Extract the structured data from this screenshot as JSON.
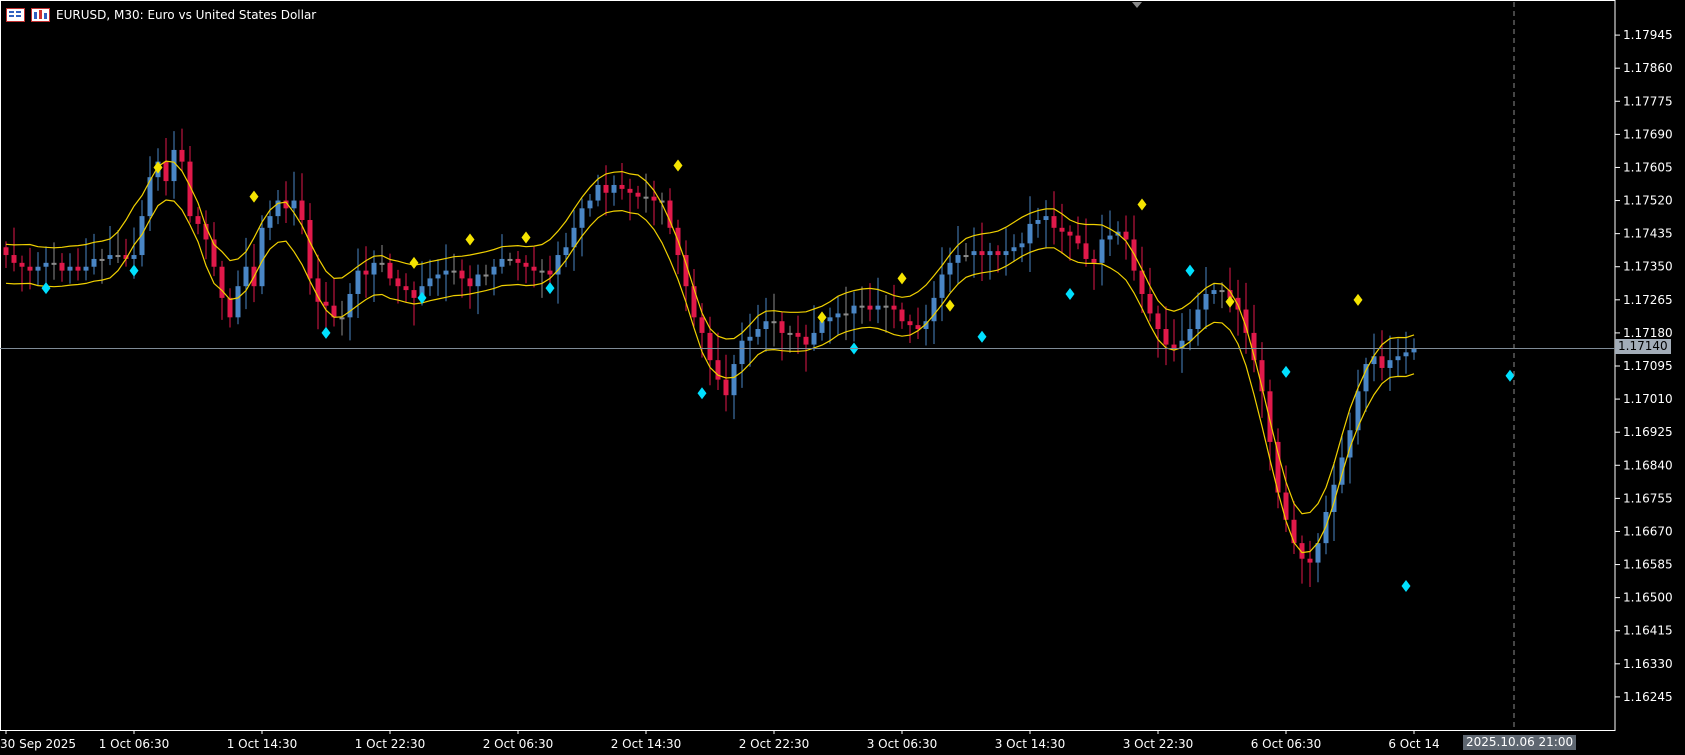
{
  "header": {
    "symbol_line": "EURUSD, M30:  Euro vs United States Dollar"
  },
  "current_price_label": "1.17140",
  "current_datetime_label": "2025.10.06 21:00",
  "colors": {
    "background": "#000000",
    "bull": "#4a86c5",
    "bear": "#e0194a",
    "neutral": "#8c8c8c",
    "band": "#f0d000",
    "buy_signal": "#00e0ff",
    "sell_signal": "#f5e400",
    "axis": "#ffffff",
    "price_line": "#7f8b97"
  },
  "chart_data": {
    "type": "candlestick",
    "y_axis": {
      "range": [
        1.1616,
        1.1803
      ],
      "ticks": [
        "1.17945",
        "1.17860",
        "1.17775",
        "1.17690",
        "1.17605",
        "1.17520",
        "1.17435",
        "1.17350",
        "1.17265",
        "1.17180",
        "1.17095",
        "1.17010",
        "1.16925",
        "1.16840",
        "1.16755",
        "1.16670",
        "1.16585",
        "1.16500",
        "1.16415",
        "1.16330",
        "1.16245"
      ]
    },
    "x_axis": {
      "ticks": [
        {
          "label": "30 Sep 2025",
          "bar": 0
        },
        {
          "label": "1 Oct 06:30",
          "bar": 16
        },
        {
          "label": "1 Oct 14:30",
          "bar": 32
        },
        {
          "label": "1 Oct 22:30",
          "bar": 48
        },
        {
          "label": "2 Oct 06:30",
          "bar": 64
        },
        {
          "label": "2 Oct 14:30",
          "bar": 80
        },
        {
          "label": "2 Oct 22:30",
          "bar": 96
        },
        {
          "label": "3 Oct 06:30",
          "bar": 112
        },
        {
          "label": "3 Oct 14:30",
          "bar": 128
        },
        {
          "label": "3 Oct 22:30",
          "bar": 144
        },
        {
          "label": "6 Oct 06:30",
          "bar": 160
        },
        {
          "label": "6 Oct 14",
          "bar": 176
        }
      ]
    },
    "current_price": 1.1714,
    "series_close": [
      1.1738,
      1.1736,
      1.1735,
      1.1734,
      1.1735,
      1.1736,
      1.1736,
      1.1734,
      1.1735,
      1.1734,
      1.1735,
      1.1737,
      1.1737,
      1.1738,
      1.1738,
      1.1737,
      1.1738,
      1.1748,
      1.1758,
      1.1762,
      1.1757,
      1.1765,
      1.1762,
      1.1748,
      1.1746,
      1.1742,
      1.1735,
      1.1727,
      1.1722,
      1.173,
      1.1735,
      1.173,
      1.1745,
      1.1748,
      1.1752,
      1.175,
      1.1752,
      1.1747,
      1.1732,
      1.1726,
      1.1725,
      1.1722,
      1.1722,
      1.1728,
      1.1734,
      1.1733,
      1.1736,
      1.1736,
      1.1732,
      1.173,
      1.1729,
      1.1727,
      1.173,
      1.1732,
      1.1733,
      1.1734,
      1.1734,
      1.1732,
      1.173,
      1.1733,
      1.1733,
      1.1735,
      1.1737,
      1.1737,
      1.1736,
      1.1735,
      1.1734,
      1.1734,
      1.1733,
      1.1738,
      1.174,
      1.1745,
      1.175,
      1.1752,
      1.1756,
      1.1754,
      1.1756,
      1.1755,
      1.1754,
      1.1753,
      1.1753,
      1.1752,
      1.1752,
      1.1745,
      1.1738,
      1.173,
      1.1722,
      1.1718,
      1.1711,
      1.1706,
      1.1702,
      1.171,
      1.1716,
      1.1717,
      1.1719,
      1.1721,
      1.1721,
      1.1718,
      1.1718,
      1.1717,
      1.1715,
      1.1718,
      1.1721,
      1.1722,
      1.1723,
      1.1723,
      1.1725,
      1.1725,
      1.1724,
      1.1725,
      1.1725,
      1.1724,
      1.1721,
      1.172,
      1.1719,
      1.1721,
      1.1727,
      1.1733,
      1.1736,
      1.1738,
      1.1738,
      1.1739,
      1.1738,
      1.1739,
      1.1738,
      1.1739,
      1.174,
      1.1741,
      1.1746,
      1.1747,
      1.1748,
      1.1745,
      1.1744,
      1.1743,
      1.1741,
      1.1737,
      1.1736,
      1.1742,
      1.1743,
      1.1744,
      1.1742,
      1.1734,
      1.1728,
      1.1723,
      1.1719,
      1.1715,
      1.1714,
      1.1716,
      1.1719,
      1.1724,
      1.1728,
      1.1729,
      1.1729,
      1.1727,
      1.1724,
      1.1718,
      1.1711,
      1.1703,
      1.169,
      1.1677,
      1.167,
      1.1664,
      1.166,
      1.1659,
      1.1664,
      1.1672,
      1.1679,
      1.1686,
      1.1693,
      1.1703,
      1.171,
      1.1712,
      1.1709,
      1.1711,
      1.1712,
      1.1713,
      1.1714
    ]
  },
  "signals": {
    "sell": [
      {
        "bar": 19,
        "price": 1.17605
      },
      {
        "bar": 31,
        "price": 1.1753
      },
      {
        "bar": 51,
        "price": 1.1736
      },
      {
        "bar": 58,
        "price": 1.1742
      },
      {
        "bar": 65,
        "price": 1.17425
      },
      {
        "bar": 84,
        "price": 1.1761
      },
      {
        "bar": 102,
        "price": 1.1722
      },
      {
        "bar": 112,
        "price": 1.1732
      },
      {
        "bar": 118,
        "price": 1.1725
      },
      {
        "bar": 142,
        "price": 1.1751
      },
      {
        "bar": 153,
        "price": 1.1726
      },
      {
        "bar": 169,
        "price": 1.17265
      }
    ],
    "buy": [
      {
        "bar": 5,
        "price": 1.17295
      },
      {
        "bar": 16,
        "price": 1.1734
      },
      {
        "bar": 40,
        "price": 1.1718
      },
      {
        "bar": 52,
        "price": 1.1727
      },
      {
        "bar": 68,
        "price": 1.17295
      },
      {
        "bar": 87,
        "price": 1.17025
      },
      {
        "bar": 106,
        "price": 1.1714
      },
      {
        "bar": 122,
        "price": 1.1717
      },
      {
        "bar": 133,
        "price": 1.1728
      },
      {
        "bar": 148,
        "price": 1.1734
      },
      {
        "bar": 160,
        "price": 1.1708
      },
      {
        "bar": 175,
        "price": 1.1653
      },
      {
        "bar": 188,
        "price": 1.1707
      }
    ]
  }
}
